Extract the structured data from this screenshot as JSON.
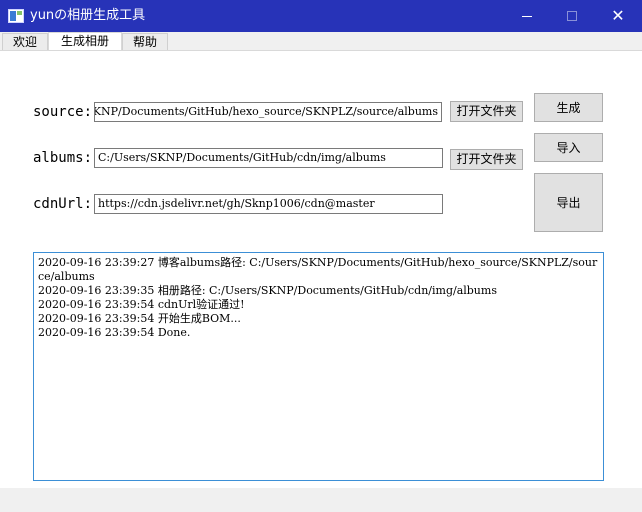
{
  "window": {
    "title": "yunの相册生成工具",
    "minimize_glyph": "",
    "close_glyph": "✕"
  },
  "tabs": [
    {
      "label": "欢迎",
      "active": false
    },
    {
      "label": "生成相册",
      "active": true
    },
    {
      "label": "帮助",
      "active": false
    }
  ],
  "form": {
    "source_label": "source:",
    "source_value": "C:/Users/SKNP/Documents/GitHub/hexo_source/SKNPLZ/source/albums",
    "albums_label": "albums:",
    "albums_value": "C:/Users/SKNP/Documents/GitHub/cdn/img/albums",
    "cdn_label": "cdnUrl:",
    "cdn_value": "https://cdn.jsdelivr.net/gh/Sknp1006/cdn@master",
    "browse_label": "打开文件夹"
  },
  "actions": {
    "generate": "生成",
    "import": "导入",
    "export": "导出"
  },
  "log": [
    "2020-09-16 23:39:27 博客albums路径: C:/Users/SKNP/Documents/GitHub/hexo_source/SKNPLZ/source/albums",
    "2020-09-16 23:39:35 相册路径: C:/Users/SKNP/Documents/GitHub/cdn/img/albums",
    "2020-09-16 23:39:54 cdnUrl验证通过!",
    "2020-09-16 23:39:54 开始生成BOM...",
    "2020-09-16 23:39:54 Done."
  ],
  "colors": {
    "titlebar": "#2733b8",
    "log_border": "#3c8fd6"
  }
}
